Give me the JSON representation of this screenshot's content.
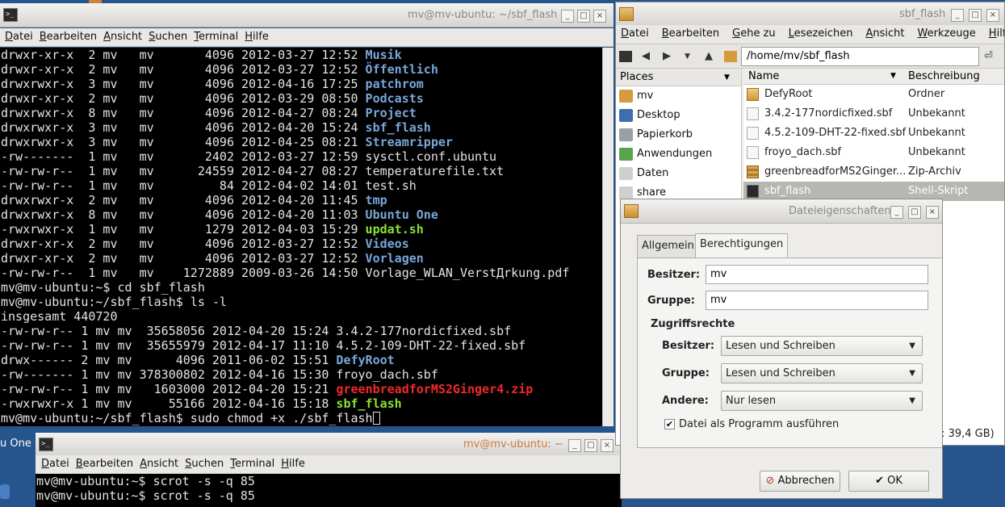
{
  "term_main": {
    "title": "mv@mv-ubuntu: ~/sbf_flash",
    "menu": [
      "Datei",
      "Bearbeiten",
      "Ansicht",
      "Suchen",
      "Terminal",
      "Hilfe"
    ],
    "lines": [
      [
        {
          "t": "drwxr-xr-x  2 mv   mv       4096 2012-03-27 12:52 "
        },
        {
          "t": "Musik",
          "c": "dir"
        }
      ],
      [
        {
          "t": "drwxr-xr-x  2 mv   mv       4096 2012-03-27 12:52 "
        },
        {
          "t": "Öffentlich",
          "c": "dir"
        }
      ],
      [
        {
          "t": "drwxrwxr-x  3 mv   mv       4096 2012-04-16 17:25 "
        },
        {
          "t": "patchrom",
          "c": "dir"
        }
      ],
      [
        {
          "t": "drwxr-xr-x  2 mv   mv       4096 2012-03-29 08:50 "
        },
        {
          "t": "Podcasts",
          "c": "dir"
        }
      ],
      [
        {
          "t": "drwxrwxr-x  8 mv   mv       4096 2012-04-27 08:24 "
        },
        {
          "t": "Project",
          "c": "dir"
        }
      ],
      [
        {
          "t": "drwxrwxr-x  3 mv   mv       4096 2012-04-20 15:24 "
        },
        {
          "t": "sbf_flash",
          "c": "dir"
        }
      ],
      [
        {
          "t": "drwxrwxr-x  3 mv   mv       4096 2012-04-25 08:21 "
        },
        {
          "t": "Streamripper",
          "c": "dir"
        }
      ],
      [
        {
          "t": "-rw-------  1 mv   mv       2402 2012-03-27 12:59 sysctl.conf.ubuntu"
        }
      ],
      [
        {
          "t": "-rw-rw-r--  1 mv   mv      24559 2012-04-27 08:27 temperaturefile.txt"
        }
      ],
      [
        {
          "t": "-rw-rw-r--  1 mv   mv         84 2012-04-02 14:01 test.sh"
        }
      ],
      [
        {
          "t": "drwxrwxr-x  2 mv   mv       4096 2012-04-20 11:45 "
        },
        {
          "t": "tmp",
          "c": "dir"
        }
      ],
      [
        {
          "t": "drwxrwxr-x  8 mv   mv       4096 2012-04-20 11:03 "
        },
        {
          "t": "Ubuntu One",
          "c": "dir"
        }
      ],
      [
        {
          "t": "-rwxrwxr-x  1 mv   mv       1279 2012-04-03 15:29 "
        },
        {
          "t": "updat.sh",
          "c": "exe"
        }
      ],
      [
        {
          "t": "drwxr-xr-x  2 mv   mv       4096 2012-03-27 12:52 "
        },
        {
          "t": "Videos",
          "c": "dir"
        }
      ],
      [
        {
          "t": "drwxr-xr-x  2 mv   mv       4096 2012-03-27 12:52 "
        },
        {
          "t": "Vorlagen",
          "c": "dir"
        }
      ],
      [
        {
          "t": "-rw-rw-r--  1 mv   mv    1272889 2009-03-26 14:50 Vorlage_WLAN_VerstДrkung.pdf"
        }
      ],
      [
        {
          "t": "mv@mv-ubuntu:~$ cd sbf_flash"
        }
      ],
      [
        {
          "t": "mv@mv-ubuntu:~/sbf_flash$ ls -l"
        }
      ],
      [
        {
          "t": "insgesamt 440720"
        }
      ],
      [
        {
          "t": "-rw-rw-r-- 1 mv mv  35658056 2012-04-20 15:24 3.4.2-177nordicfixed.sbf"
        }
      ],
      [
        {
          "t": "-rw-rw-r-- 1 mv mv  35655979 2012-04-17 11:10 4.5.2-109-DHT-22-fixed.sbf"
        }
      ],
      [
        {
          "t": "drwx------ 2 mv mv      4096 2011-06-02 15:51 "
        },
        {
          "t": "DefyRoot",
          "c": "dir"
        }
      ],
      [
        {
          "t": "-rw------- 1 mv mv 378300802 2012-04-16 15:30 froyo_dach.sbf"
        }
      ],
      [
        {
          "t": "-rw-rw-r-- 1 mv mv   1603000 2012-04-20 15:21 "
        },
        {
          "t": "greenbreadforMS2Ginger4.zip",
          "c": "zip"
        }
      ],
      [
        {
          "t": "-rwxrwxr-x 1 mv mv     55166 2012-04-16 15:18 "
        },
        {
          "t": "sbf_flash",
          "c": "exe"
        }
      ],
      [
        {
          "t": "mv@mv-ubuntu:~/sbf_flash$ sudo chmod +x ./sbf_flash"
        }
      ]
    ]
  },
  "term_bottom": {
    "title": "mv@mv-ubuntu: ~",
    "menu": [
      "Datei",
      "Bearbeiten",
      "Ansicht",
      "Suchen",
      "Terminal",
      "Hilfe"
    ],
    "lines": [
      [
        {
          "t": "mv@mv-ubuntu:~$ scrot -s -q 85"
        }
      ],
      [
        {
          "t": "mv@mv-ubuntu:~$ scrot -s -q 85"
        }
      ]
    ]
  },
  "desktop": {
    "label": "u One"
  },
  "filemanager": {
    "title": "sbf_flash",
    "menu": [
      "Datei",
      "Bearbeiten",
      "Gehe zu",
      "Lesezeichen",
      "Ansicht",
      "Werkzeuge",
      "Hilfe"
    ],
    "path": "/home/mv/sbf_flash",
    "places_header": "Places",
    "places": [
      {
        "label": "mv",
        "color": "#d79a3c"
      },
      {
        "label": "Desktop",
        "color": "#3d6fb0"
      },
      {
        "label": "Papierkorb",
        "color": "#9aa0a6"
      },
      {
        "label": "Anwendungen",
        "color": "#5aa34a"
      },
      {
        "label": "Daten",
        "color": "#cfcfcf"
      },
      {
        "label": "share",
        "color": "#cfcfcf"
      }
    ],
    "columns": {
      "name": "Name",
      "desc": "Beschreibung"
    },
    "files": [
      {
        "name": "DefyRoot",
        "desc": "Ordner",
        "icon": "fold"
      },
      {
        "name": "3.4.2-177nordicfixed.sbf",
        "desc": "Unbekannt",
        "icon": "file"
      },
      {
        "name": "4.5.2-109-DHT-22-fixed.sbf",
        "desc": "Unbekannt",
        "icon": "file"
      },
      {
        "name": "froyo_dach.sbf",
        "desc": "Unbekannt",
        "icon": "file"
      },
      {
        "name": "greenbreadforMS2Ginger...",
        "desc": "Zip-Archiv",
        "icon": "zip"
      },
      {
        "name": "sbf_flash",
        "desc": "Shell-Skript",
        "icon": "sh"
      }
    ],
    "status": "t: 39,4 GB)"
  },
  "dialog": {
    "title": "Dateieigenschaften",
    "tab_general": "Allgemein",
    "tab_perms": "Berechtigungen",
    "owner_label": "Besitzer:",
    "owner_value": "mv",
    "group_label": "Gruppe:",
    "group_value": "mv",
    "access_title": "Zugriffsrechte",
    "owner_access_label": "Besitzer:",
    "owner_access": "Lesen und Schreiben",
    "group_access_label": "Gruppe:",
    "group_access": "Lesen und Schreiben",
    "others_label": "Andere:",
    "others_access": "Nur lesen",
    "exec_label": "Datei als Programm ausführen",
    "exec_checked": true,
    "cancel": "Abbrechen",
    "ok": "OK"
  }
}
